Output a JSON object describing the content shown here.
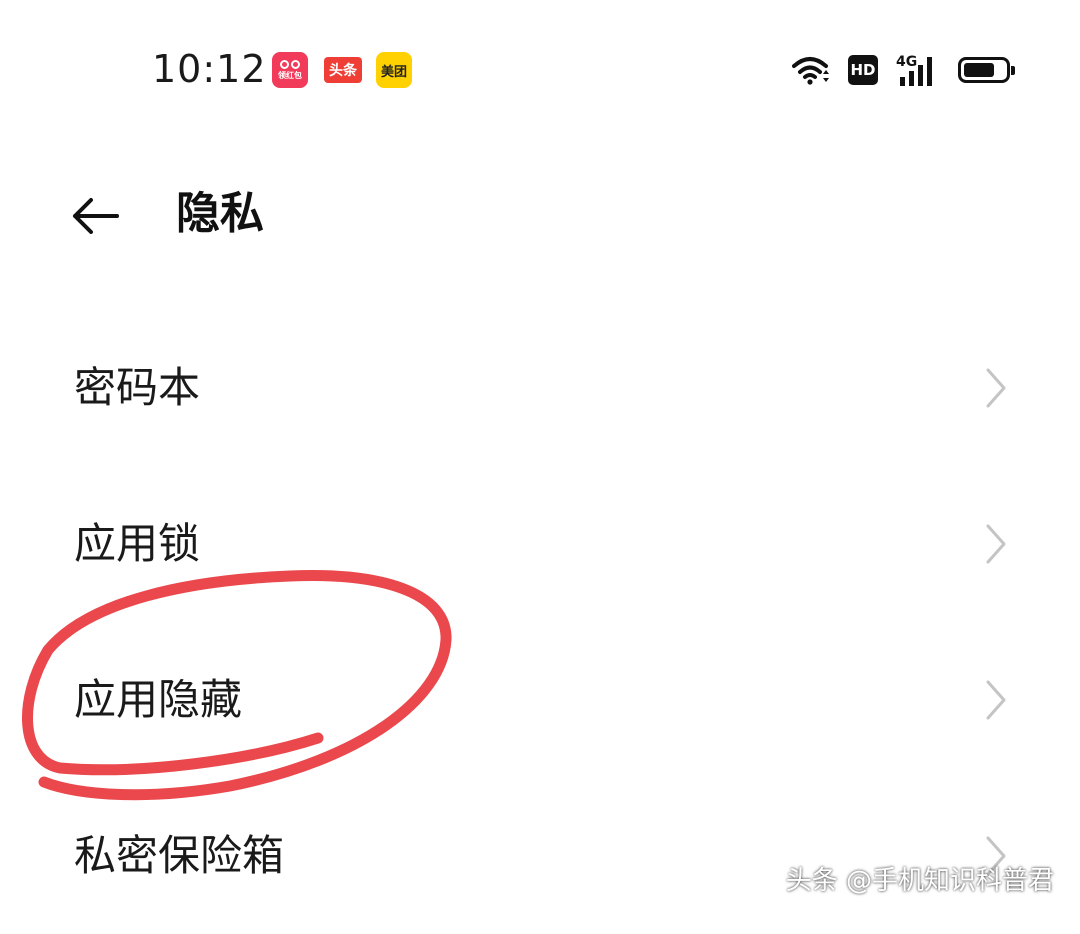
{
  "status_bar": {
    "time": "10:12",
    "notification_apps": [
      {
        "name": "redbag-app-icon",
        "label": "领红包"
      },
      {
        "name": "toutiao-app-icon",
        "label": "头条"
      },
      {
        "name": "meituan-app-icon",
        "label": "美团"
      }
    ],
    "hd_label": "HD",
    "network_label": "4G",
    "battery_level": 0.75
  },
  "header": {
    "back_icon": "arrow-left-icon",
    "title": "隐私"
  },
  "menu": {
    "items": [
      {
        "label": "密码本",
        "icon": "chevron-right-icon"
      },
      {
        "label": "应用锁",
        "icon": "chevron-right-icon"
      },
      {
        "label": "应用隐藏",
        "icon": "chevron-right-icon"
      },
      {
        "label": "私密保险箱",
        "icon": "chevron-right-icon"
      }
    ]
  },
  "annotation": {
    "color": "#e8383d",
    "highlighted_item": "应用隐藏"
  },
  "watermark": {
    "text": "头条 @手机知识科普君"
  }
}
